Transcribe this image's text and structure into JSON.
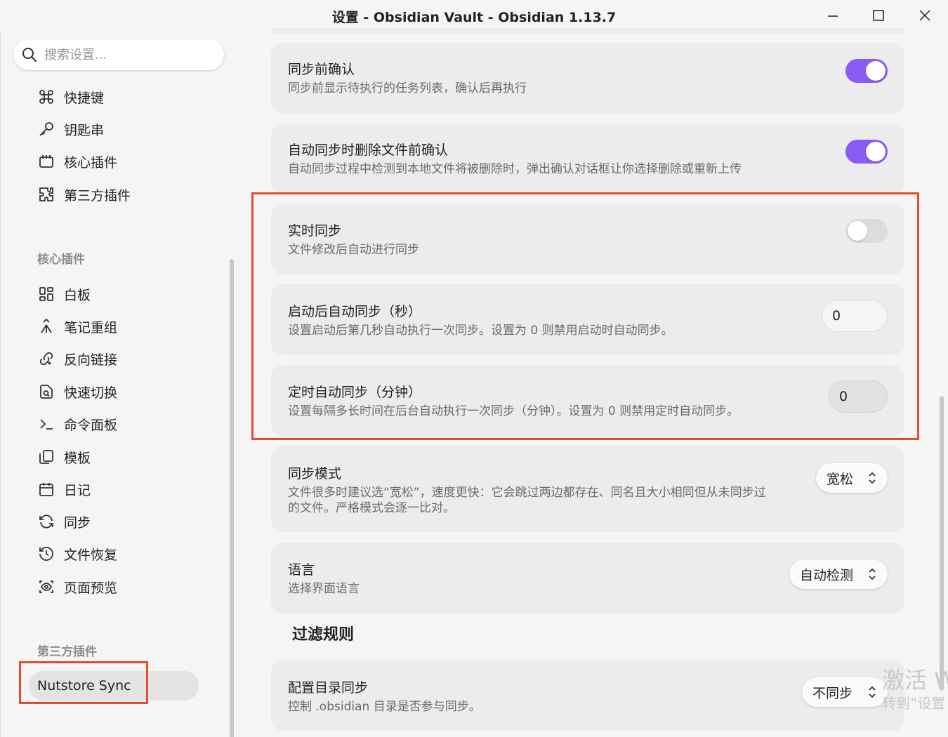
{
  "window": {
    "title": "设置 - Obsidian Vault - Obsidian 1.13.7"
  },
  "search": {
    "placeholder": "搜索设置..."
  },
  "sidebar": {
    "options_items": [
      {
        "label": "快捷键",
        "icon": "command-icon"
      },
      {
        "label": "钥匙串",
        "icon": "key-icon"
      },
      {
        "label": "核心插件",
        "icon": "calendar-box-icon"
      },
      {
        "label": "第三方插件",
        "icon": "puzzle-icon"
      }
    ],
    "core_header": "核心插件",
    "core_items": [
      {
        "label": "白板",
        "icon": "canvas-icon"
      },
      {
        "label": "笔记重组",
        "icon": "merge-icon"
      },
      {
        "label": "反向链接",
        "icon": "backlink-icon"
      },
      {
        "label": "快速切换",
        "icon": "file-search-icon"
      },
      {
        "label": "命令面板",
        "icon": "terminal-icon"
      },
      {
        "label": "模板",
        "icon": "copy-icon"
      },
      {
        "label": "日记",
        "icon": "calendar-icon"
      },
      {
        "label": "同步",
        "icon": "sync-icon"
      },
      {
        "label": "文件恢复",
        "icon": "history-icon"
      },
      {
        "label": "页面预览",
        "icon": "preview-icon"
      }
    ],
    "third_header": "第三方插件",
    "third_items": [
      {
        "label": "Nutstore Sync",
        "active": true
      }
    ]
  },
  "settings": [
    {
      "name": "同步前确认",
      "desc": "同步前显示待执行的任务列表，确认后再执行",
      "control": "toggle",
      "value": true
    },
    {
      "name": "自动同步时删除文件前确认",
      "desc": "自动同步过程中检测到本地文件将被删除时，弹出确认对话框让你选择删除或重新上传",
      "control": "toggle",
      "value": true
    },
    {
      "name": "实时同步",
      "desc": "文件修改后自动进行同步",
      "control": "toggle",
      "value": false
    },
    {
      "name": "启动后自动同步（秒）",
      "desc": "设置启动后第几秒自动执行一次同步。设置为 0 则禁用启动时自动同步。",
      "control": "number",
      "value": "0"
    },
    {
      "name": "定时自动同步（分钟）",
      "desc": "设置每隔多长时间在后台自动执行一次同步（分钟）。设置为 0 则禁用定时自动同步。",
      "control": "number",
      "value": "0"
    },
    {
      "name": "同步模式",
      "desc_lines": [
        "文件很多时建议选“宽松”，速度更快：它会跳过两边都存在、同名且大小相同但从未同步过",
        "的文件。严格模式会逐一比对。"
      ],
      "control": "select",
      "value": "宽松"
    },
    {
      "name": "语言",
      "desc": "选择界面语言",
      "control": "select",
      "value": "自动检测"
    },
    {
      "name": "配置目录同步",
      "desc": "控制 .obsidian 目录是否参与同步。",
      "control": "select",
      "value": "不同步"
    }
  ],
  "filter_heading": "过滤规则",
  "watermark": {
    "line1": "激活 W",
    "line2": "转到“设置"
  },
  "colors": {
    "accent": "#8a5cf5",
    "highlight": "#e04e2e",
    "card_bg": "#ececec"
  }
}
